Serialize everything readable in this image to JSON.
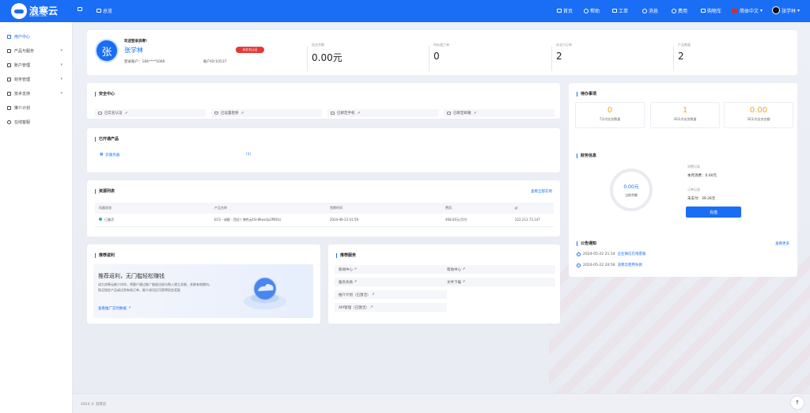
{
  "header": {
    "logo_text": "浪寒云",
    "logo_sub": "LANGHAN CLOUD",
    "console": "总览",
    "nav": [
      "首页",
      "帮助",
      "工单",
      "消息",
      "费用",
      "购物车"
    ],
    "language": "简体中文",
    "username": "张学林"
  },
  "sidebar": {
    "items": [
      {
        "label": "用户中心",
        "icon": "user-center-icon"
      },
      {
        "label": "产品与服务",
        "icon": "grid-icon",
        "expand": "▾"
      },
      {
        "label": "账户管理",
        "icon": "user-icon",
        "expand": "▾"
      },
      {
        "label": "财务管理",
        "icon": "finance-icon",
        "expand": "▾"
      },
      {
        "label": "技术支持",
        "icon": "support-icon",
        "expand": "▾"
      },
      {
        "label": "推介计划",
        "icon": "send-icon"
      },
      {
        "label": "在线客服",
        "icon": "bell-icon"
      }
    ]
  },
  "profile": {
    "avatar_char": "张",
    "welcome": "欢迎登录浪寒！",
    "name": "张学林",
    "badge": "未实名认证",
    "login_account": "登录账户：186****5066",
    "account_id": "账户ID:10537",
    "stats": [
      {
        "label": "现金余额",
        "value": "0.00元"
      },
      {
        "label": "待处理工单",
        "value": "0"
      },
      {
        "label": "未支付订单",
        "value": "2"
      },
      {
        "label": "产品数量",
        "value": "2"
      }
    ]
  },
  "security": {
    "title": "安全中心",
    "items": [
      "已实名认证",
      "已设置密保",
      "已绑定手机",
      "已绑定邮箱"
    ]
  },
  "todo": {
    "title": "待办事项",
    "items": [
      {
        "value": "0",
        "label": "7天内业务数量"
      },
      {
        "value": "1",
        "label": "30天内业务数量"
      },
      {
        "value": "0.00",
        "label": "30天内业务金额"
      }
    ]
  },
  "opened": {
    "title": "已开通产品",
    "product": "云服务器",
    "count": "(1)"
  },
  "finance": {
    "title": "财务信息",
    "gauge_value": "0.00元",
    "gauge_label": "当前余额",
    "consume_title": "消费记录",
    "consume_text": "本月消费：0.00元",
    "order_title": "订单记录",
    "order_text": "未支付：39.26元",
    "button": "充值"
  },
  "resources": {
    "title": "资源列表",
    "more": "查看全部实例",
    "columns": [
      "机器状态",
      "产品名称",
      "到期时间",
      "费用",
      "IP"
    ],
    "rows": [
      {
        "status": "已激活",
        "name": "ECS - 成都 - 西信 ( 弹性云t5nl6lwx3p2PBOc)",
        "expire": "2024-06-23 01:59",
        "fee": "468.00元/月付",
        "ip": "222.211.73.147"
      }
    ]
  },
  "notice": {
    "title": "公告通知",
    "more": "查看更多",
    "items": [
      {
        "time": "2024-05-22 21:14",
        "text": "企业微信在线客服"
      },
      {
        "time": "2024-05-22 20:56",
        "text": "浪寒云使用条款"
      }
    ]
  },
  "recommend": {
    "title": "推荐返利",
    "headline": "推荐返利，无门槛轻松赚钱",
    "desc": "成为浪寒云推介伙伴，将客户通过推广链接注册与购入建立关联，关联有效期内，购买指定产品或达到有效订单，推介成功后可获得现金奖励",
    "link": "查看推广实时数据"
  },
  "services": {
    "title": "推荐服务",
    "items": [
      "新闻中心",
      "帮助中心",
      "服务条款",
      "文件下载",
      "推介计划（已激活）",
      "API管理（已激活）"
    ]
  },
  "footer": {
    "copyright": "2024 © 浪寒云"
  }
}
